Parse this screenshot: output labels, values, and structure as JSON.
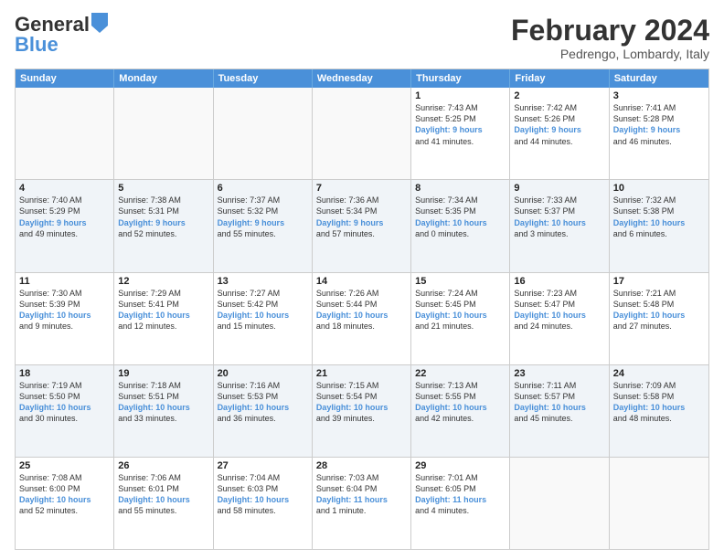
{
  "logo": {
    "part1": "General",
    "part2": "Blue"
  },
  "title": "February 2024",
  "location": "Pedrengo, Lombardy, Italy",
  "headers": [
    "Sunday",
    "Monday",
    "Tuesday",
    "Wednesday",
    "Thursday",
    "Friday",
    "Saturday"
  ],
  "weeks": [
    [
      {
        "day": "",
        "lines": []
      },
      {
        "day": "",
        "lines": []
      },
      {
        "day": "",
        "lines": []
      },
      {
        "day": "",
        "lines": []
      },
      {
        "day": "1",
        "lines": [
          "Sunrise: 7:43 AM",
          "Sunset: 5:25 PM",
          "Daylight: 9 hours",
          "and 41 minutes."
        ]
      },
      {
        "day": "2",
        "lines": [
          "Sunrise: 7:42 AM",
          "Sunset: 5:26 PM",
          "Daylight: 9 hours",
          "and 44 minutes."
        ]
      },
      {
        "day": "3",
        "lines": [
          "Sunrise: 7:41 AM",
          "Sunset: 5:28 PM",
          "Daylight: 9 hours",
          "and 46 minutes."
        ]
      }
    ],
    [
      {
        "day": "4",
        "lines": [
          "Sunrise: 7:40 AM",
          "Sunset: 5:29 PM",
          "Daylight: 9 hours",
          "and 49 minutes."
        ]
      },
      {
        "day": "5",
        "lines": [
          "Sunrise: 7:38 AM",
          "Sunset: 5:31 PM",
          "Daylight: 9 hours",
          "and 52 minutes."
        ]
      },
      {
        "day": "6",
        "lines": [
          "Sunrise: 7:37 AM",
          "Sunset: 5:32 PM",
          "Daylight: 9 hours",
          "and 55 minutes."
        ]
      },
      {
        "day": "7",
        "lines": [
          "Sunrise: 7:36 AM",
          "Sunset: 5:34 PM",
          "Daylight: 9 hours",
          "and 57 minutes."
        ]
      },
      {
        "day": "8",
        "lines": [
          "Sunrise: 7:34 AM",
          "Sunset: 5:35 PM",
          "Daylight: 10 hours",
          "and 0 minutes."
        ]
      },
      {
        "day": "9",
        "lines": [
          "Sunrise: 7:33 AM",
          "Sunset: 5:37 PM",
          "Daylight: 10 hours",
          "and 3 minutes."
        ]
      },
      {
        "day": "10",
        "lines": [
          "Sunrise: 7:32 AM",
          "Sunset: 5:38 PM",
          "Daylight: 10 hours",
          "and 6 minutes."
        ]
      }
    ],
    [
      {
        "day": "11",
        "lines": [
          "Sunrise: 7:30 AM",
          "Sunset: 5:39 PM",
          "Daylight: 10 hours",
          "and 9 minutes."
        ]
      },
      {
        "day": "12",
        "lines": [
          "Sunrise: 7:29 AM",
          "Sunset: 5:41 PM",
          "Daylight: 10 hours",
          "and 12 minutes."
        ]
      },
      {
        "day": "13",
        "lines": [
          "Sunrise: 7:27 AM",
          "Sunset: 5:42 PM",
          "Daylight: 10 hours",
          "and 15 minutes."
        ]
      },
      {
        "day": "14",
        "lines": [
          "Sunrise: 7:26 AM",
          "Sunset: 5:44 PM",
          "Daylight: 10 hours",
          "and 18 minutes."
        ]
      },
      {
        "day": "15",
        "lines": [
          "Sunrise: 7:24 AM",
          "Sunset: 5:45 PM",
          "Daylight: 10 hours",
          "and 21 minutes."
        ]
      },
      {
        "day": "16",
        "lines": [
          "Sunrise: 7:23 AM",
          "Sunset: 5:47 PM",
          "Daylight: 10 hours",
          "and 24 minutes."
        ]
      },
      {
        "day": "17",
        "lines": [
          "Sunrise: 7:21 AM",
          "Sunset: 5:48 PM",
          "Daylight: 10 hours",
          "and 27 minutes."
        ]
      }
    ],
    [
      {
        "day": "18",
        "lines": [
          "Sunrise: 7:19 AM",
          "Sunset: 5:50 PM",
          "Daylight: 10 hours",
          "and 30 minutes."
        ]
      },
      {
        "day": "19",
        "lines": [
          "Sunrise: 7:18 AM",
          "Sunset: 5:51 PM",
          "Daylight: 10 hours",
          "and 33 minutes."
        ]
      },
      {
        "day": "20",
        "lines": [
          "Sunrise: 7:16 AM",
          "Sunset: 5:53 PM",
          "Daylight: 10 hours",
          "and 36 minutes."
        ]
      },
      {
        "day": "21",
        "lines": [
          "Sunrise: 7:15 AM",
          "Sunset: 5:54 PM",
          "Daylight: 10 hours",
          "and 39 minutes."
        ]
      },
      {
        "day": "22",
        "lines": [
          "Sunrise: 7:13 AM",
          "Sunset: 5:55 PM",
          "Daylight: 10 hours",
          "and 42 minutes."
        ]
      },
      {
        "day": "23",
        "lines": [
          "Sunrise: 7:11 AM",
          "Sunset: 5:57 PM",
          "Daylight: 10 hours",
          "and 45 minutes."
        ]
      },
      {
        "day": "24",
        "lines": [
          "Sunrise: 7:09 AM",
          "Sunset: 5:58 PM",
          "Daylight: 10 hours",
          "and 48 minutes."
        ]
      }
    ],
    [
      {
        "day": "25",
        "lines": [
          "Sunrise: 7:08 AM",
          "Sunset: 6:00 PM",
          "Daylight: 10 hours",
          "and 52 minutes."
        ]
      },
      {
        "day": "26",
        "lines": [
          "Sunrise: 7:06 AM",
          "Sunset: 6:01 PM",
          "Daylight: 10 hours",
          "and 55 minutes."
        ]
      },
      {
        "day": "27",
        "lines": [
          "Sunrise: 7:04 AM",
          "Sunset: 6:03 PM",
          "Daylight: 10 hours",
          "and 58 minutes."
        ]
      },
      {
        "day": "28",
        "lines": [
          "Sunrise: 7:03 AM",
          "Sunset: 6:04 PM",
          "Daylight: 11 hours",
          "and 1 minute."
        ]
      },
      {
        "day": "29",
        "lines": [
          "Sunrise: 7:01 AM",
          "Sunset: 6:05 PM",
          "Daylight: 11 hours",
          "and 4 minutes."
        ]
      },
      {
        "day": "",
        "lines": []
      },
      {
        "day": "",
        "lines": []
      }
    ]
  ]
}
